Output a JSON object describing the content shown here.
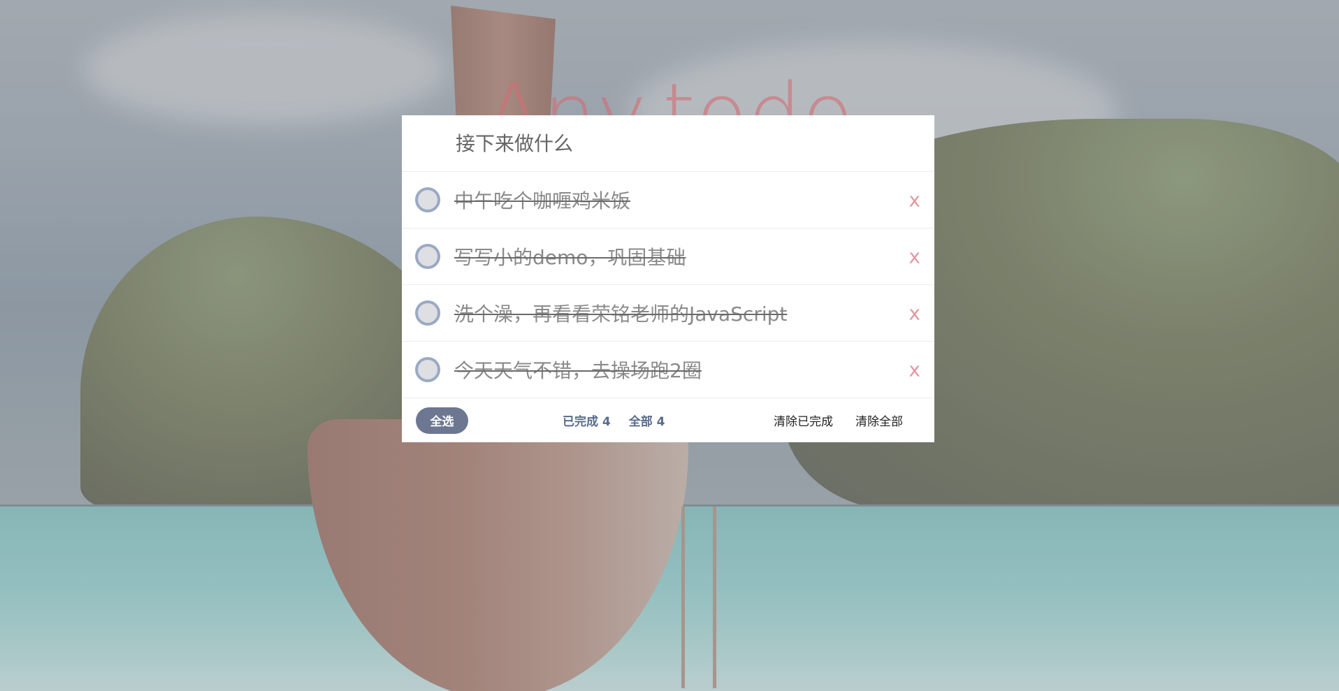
{
  "app": {
    "title": "Any.todo"
  },
  "new_todo": {
    "placeholder": "接下来做什么"
  },
  "todos": [
    {
      "text": "中午吃个咖喱鸡米饭",
      "completed": true,
      "delete_label": "x"
    },
    {
      "text": "写写小的demo，巩固基础",
      "completed": true,
      "delete_label": "x"
    },
    {
      "text": "洗个澡，再看看荣铭老师的JavaScript",
      "completed": true,
      "delete_label": "x"
    },
    {
      "text": "今天天气不错，去操场跑2圈",
      "completed": true,
      "delete_label": "x"
    }
  ],
  "footer": {
    "select_all_label": "全选",
    "completed_count": "已完成 4",
    "total_count": "全部 4",
    "clear_completed_label": "清除已完成",
    "clear_all_label": "清除全部"
  },
  "colors": {
    "title": "#d26e73",
    "accent": "#6c7891",
    "checkbox_border": "#9aaac4",
    "delete": "#e09aa0"
  }
}
